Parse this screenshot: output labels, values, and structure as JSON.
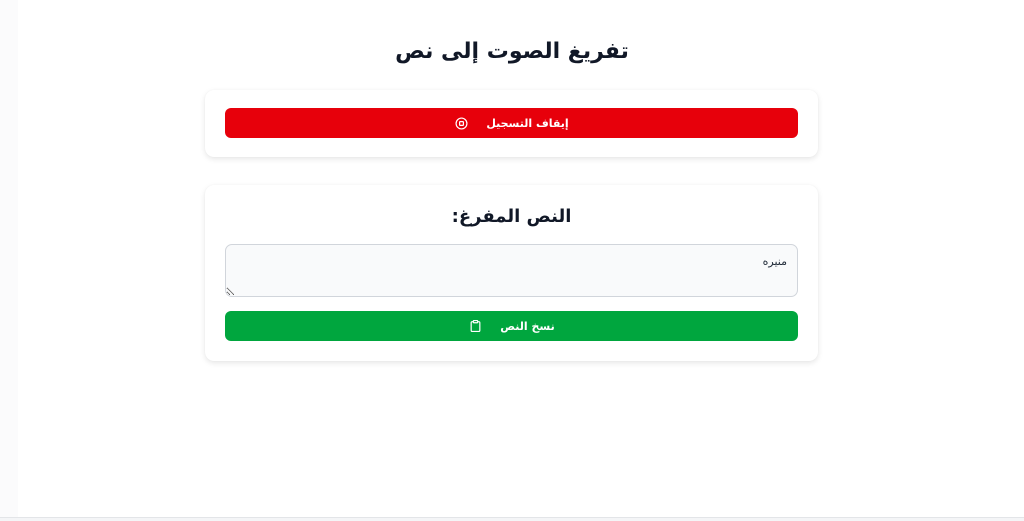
{
  "app": {
    "title": "تفريغ الصوت إلى نص"
  },
  "recording": {
    "stop_button_label": "إيقاف التسجيل",
    "stop_button_icon": "stop-circle-icon",
    "stop_button_color": "#e7000b"
  },
  "transcription": {
    "heading": ":النص المفرغ",
    "text_value": "منيره",
    "copy_button_label": "نسخ النص",
    "copy_button_icon": "clipboard-icon",
    "copy_button_color": "#00a63e"
  }
}
